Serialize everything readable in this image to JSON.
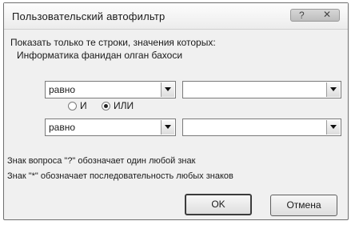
{
  "dialog": {
    "title": "Пользовательский автофильтр",
    "help_glyph": "?",
    "close_glyph": "✕"
  },
  "filter": {
    "instruction": "Показать только те строки, значения которых:",
    "field_name": "Информатика фанидан олган бахоси",
    "row1": {
      "operator": "равно",
      "value": ""
    },
    "logic": {
      "and_label": "И",
      "or_label": "ИЛИ",
      "selected": "ИЛИ"
    },
    "row2": {
      "operator": "равно",
      "value": ""
    }
  },
  "hints": {
    "question_mark": "Знак вопроса \"?\" обозначает один любой знак",
    "asterisk": "Знак \"*\" обозначает последовательность любых знаков"
  },
  "buttons": {
    "ok": "OK",
    "cancel": "Отмена"
  }
}
